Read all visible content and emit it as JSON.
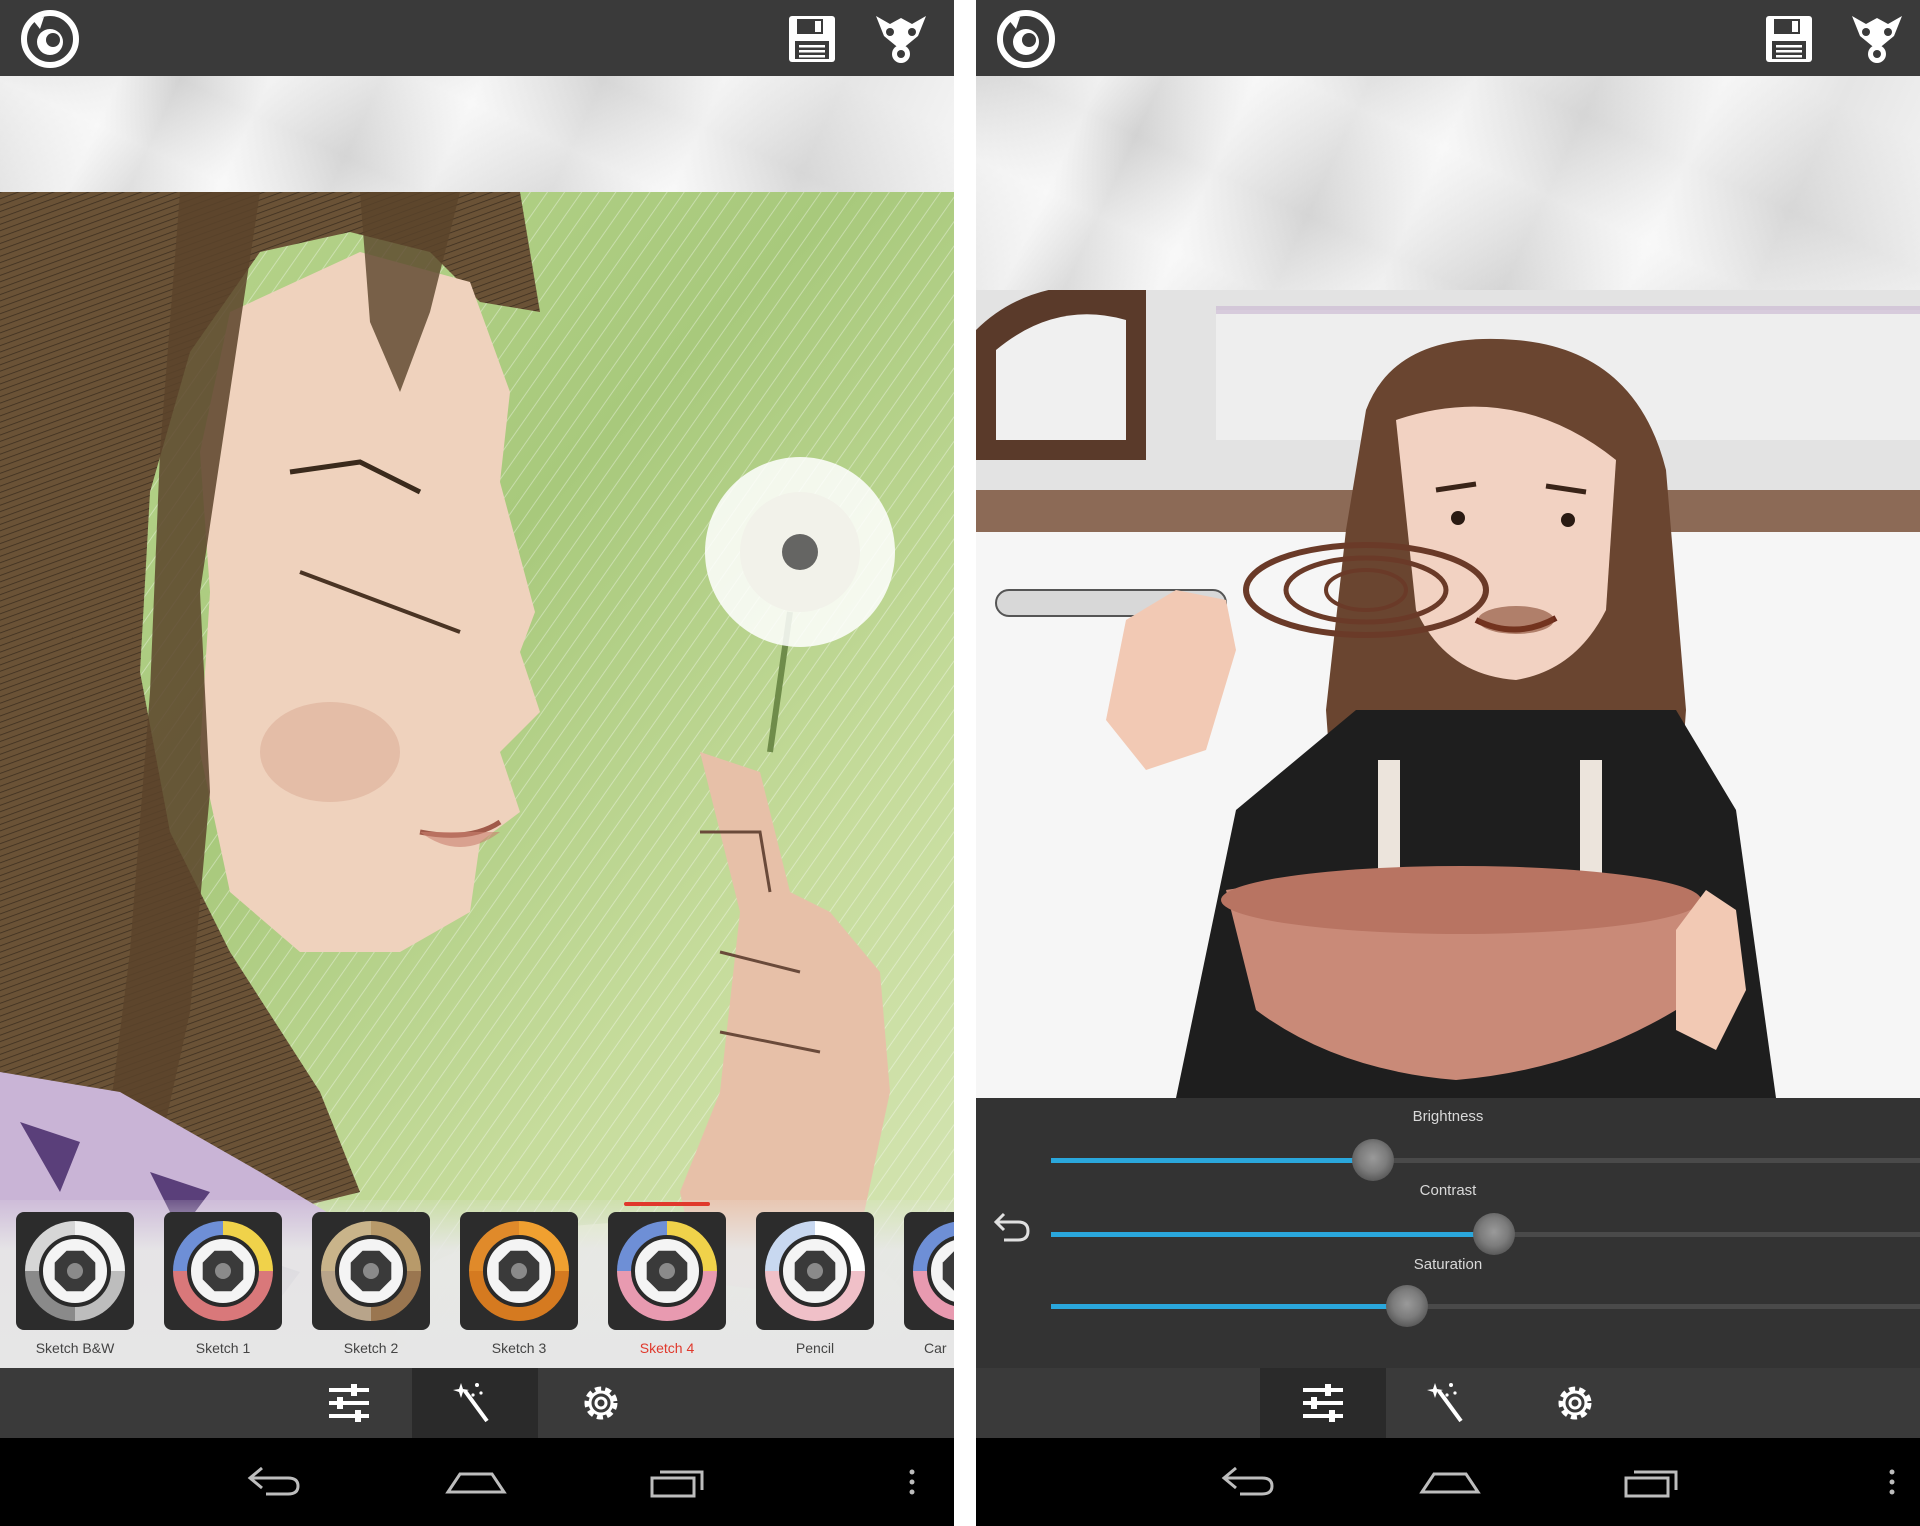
{
  "left_screen": {
    "filters": [
      {
        "label": "Sketch B&W",
        "colors": [
          "#f2f2f2",
          "#bdbdbd",
          "#8a8a8a",
          "#d6d6d6"
        ],
        "selected": false
      },
      {
        "label": "Sketch 1",
        "colors": [
          "#f0d24a",
          "#d9787a",
          "#d9787a",
          "#6e8fd6"
        ],
        "selected": false
      },
      {
        "label": "Sketch 2",
        "colors": [
          "#b89a6a",
          "#9a7650",
          "#b8a48a",
          "#c9b48a"
        ],
        "selected": false
      },
      {
        "label": "Sketch 3",
        "colors": [
          "#f0a030",
          "#d57a20",
          "#d57a20",
          "#e08a2a"
        ],
        "selected": false
      },
      {
        "label": "Sketch 4",
        "colors": [
          "#f0d24a",
          "#e89ab0",
          "#e89ab0",
          "#6e8fd6"
        ],
        "selected": true
      },
      {
        "label": "Pencil",
        "colors": [
          "#ffffff",
          "#f0c0c8",
          "#f0c0c8",
          "#c8d8f0"
        ],
        "selected": false
      },
      {
        "label": "Car",
        "colors": [
          "#f0d24a",
          "#e89ab0",
          "#e89ab0",
          "#6e8fd6"
        ],
        "selected": false
      }
    ]
  },
  "right_screen": {
    "sliders": [
      {
        "label": "Brightness",
        "value": 0.37
      },
      {
        "label": "Contrast",
        "value": 0.51
      },
      {
        "label": "Saturation",
        "value": 0.41
      }
    ]
  },
  "colors": {
    "accent_blue": "#2aa7dc",
    "selected_red": "#e0382c",
    "bar_dark": "#3a3a3a"
  },
  "icons": {
    "app_logo": "app-logo-icon",
    "save": "save-icon",
    "share": "share-icon",
    "adjust": "sliders-icon",
    "effects": "magic-wand-icon",
    "settings": "gear-icon",
    "reset": "undo-icon",
    "nav_back": "back-icon",
    "nav_home": "home-icon",
    "nav_recents": "recents-icon",
    "nav_menu": "overflow-menu-icon"
  }
}
